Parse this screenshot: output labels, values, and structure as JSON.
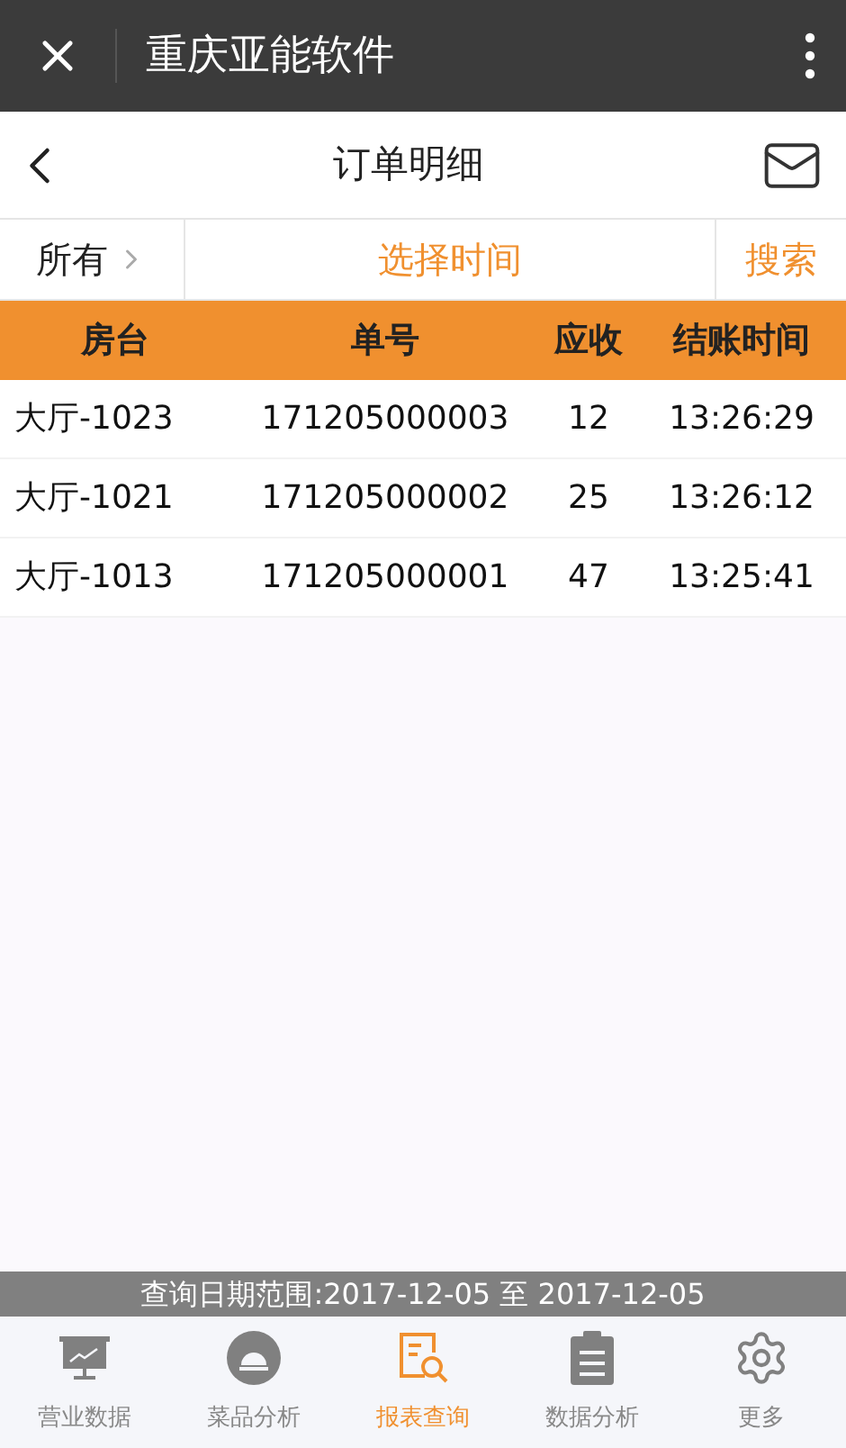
{
  "window": {
    "title": "重庆亚能软件"
  },
  "header": {
    "title": "订单明细"
  },
  "filter": {
    "scope": "所有",
    "time": "选择时间",
    "search": "搜索"
  },
  "table": {
    "columns": [
      "房台",
      "单号",
      "应收",
      "结账时间"
    ],
    "rows": [
      [
        "大厅-1023",
        "171205000003",
        "12",
        "13:26:29"
      ],
      [
        "大厅-1021",
        "171205000002",
        "25",
        "13:26:12"
      ],
      [
        "大厅-1013",
        "171205000001",
        "47",
        "13:25:41"
      ]
    ]
  },
  "status_bar": "查询日期范围:2017-12-05 至 2017-12-05",
  "tabs": [
    {
      "label": "营业数据",
      "kind": "monitor",
      "selected": false
    },
    {
      "label": "菜品分析",
      "kind": "dish",
      "selected": false
    },
    {
      "label": "报表查询",
      "kind": "report",
      "selected": true
    },
    {
      "label": "数据分析",
      "kind": "clipboard",
      "selected": false
    },
    {
      "label": "更多",
      "kind": "gear",
      "selected": false
    }
  ]
}
